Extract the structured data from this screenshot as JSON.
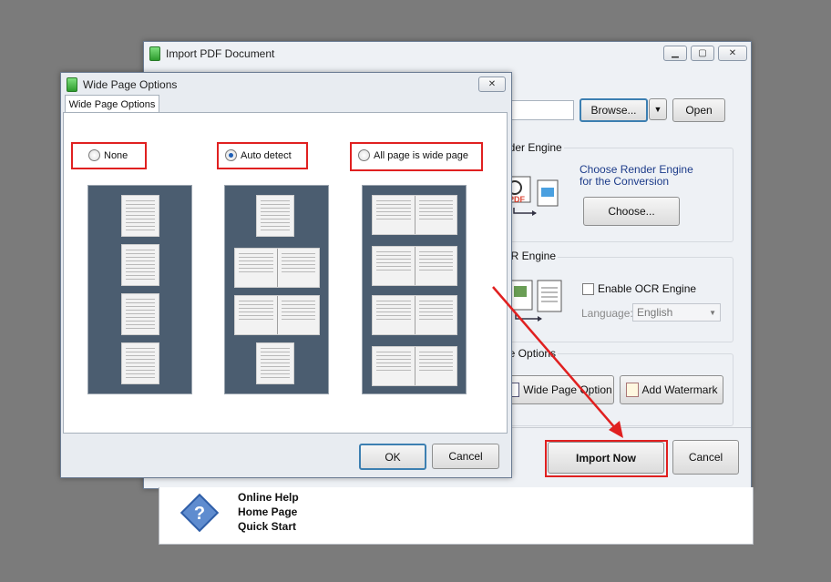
{
  "main_window": {
    "title": "Import PDF Document",
    "browse_label": "Browse...",
    "dropdown_arrow": "▼",
    "open_label": "Open",
    "render_engine": {
      "group_label": "nder Engine",
      "desc_line1": "Choose Render Engine",
      "desc_line2": "for the Conversion",
      "choose_label": "Choose..."
    },
    "ocr_engine": {
      "group_label": "CR Engine",
      "enable_label": "Enable OCR Engine",
      "language_label": "Language:",
      "language_value": "English"
    },
    "page_options": {
      "group_label": "ge Options",
      "wide_page_label": "Wide Page Option",
      "watermark_label": "Add Watermark"
    },
    "import_now_label": "Import Now",
    "cancel_label": "Cancel",
    "help_links": [
      "Online Help",
      "Home Page",
      "Quick Start"
    ]
  },
  "wide_page_dialog": {
    "title": "Wide Page Options",
    "tab_label": "Wide Page Options",
    "options": [
      {
        "label": "None",
        "selected": false
      },
      {
        "label": "Auto detect",
        "selected": true
      },
      {
        "label": "All page is wide page",
        "selected": false
      }
    ],
    "ok_label": "OK",
    "cancel_label": "Cancel"
  },
  "colors": {
    "highlight": "#e02020",
    "preview_bg": "#4b5d70",
    "accent": "#1f5fb5"
  }
}
